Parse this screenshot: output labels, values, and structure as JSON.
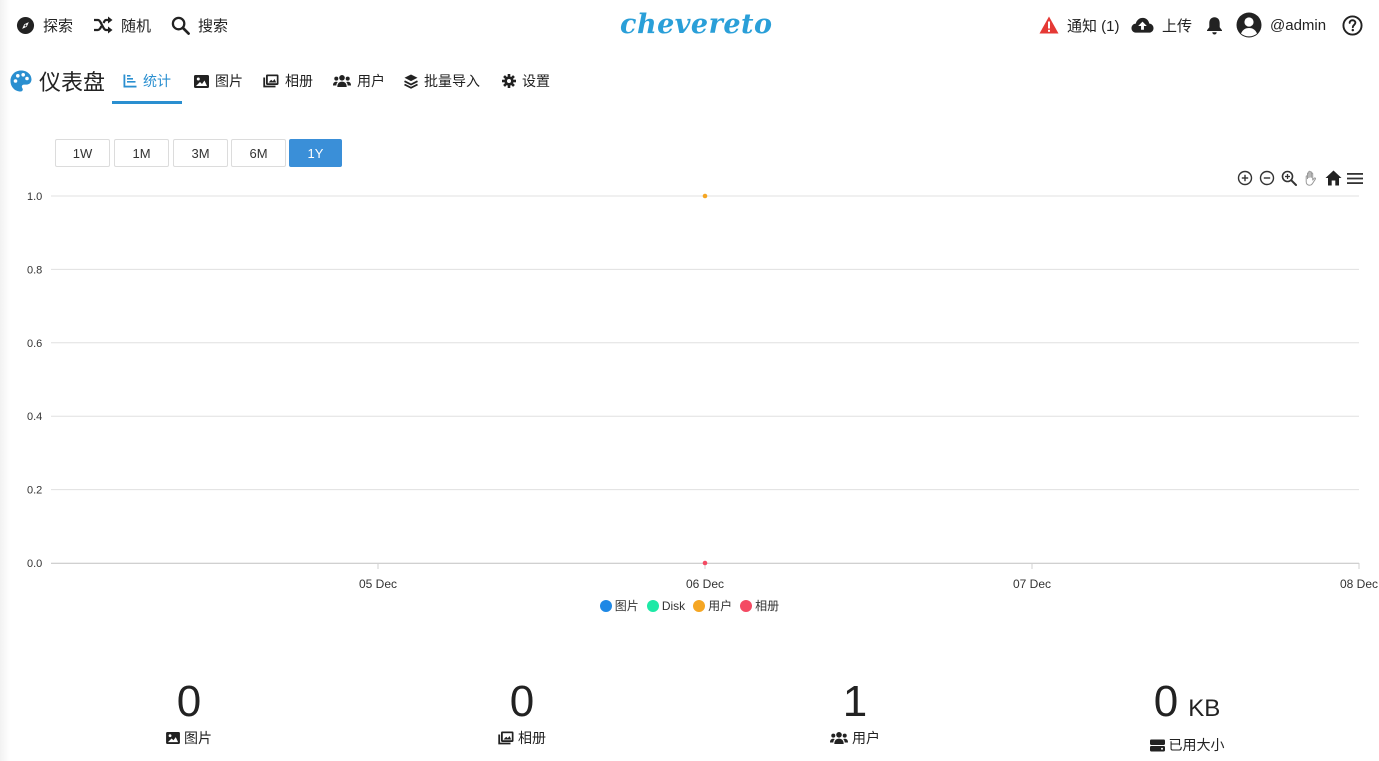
{
  "header": {
    "explore": "探索",
    "random": "随机",
    "search": "搜索",
    "logo": "chevereto",
    "notices": "通知 (1)",
    "upload": "上传",
    "user": "@admin",
    "accent_color": "#2a9fd8",
    "warning_color": "#e53935"
  },
  "tabs": {
    "dashboard": "仪表盘",
    "stats": "统计",
    "images": "图片",
    "albums": "相册",
    "users": "用户",
    "bulk": "批量导入",
    "settings": "设置"
  },
  "range": [
    "1W",
    "1M",
    "3M",
    "6M",
    "1Y"
  ],
  "range_selected": "1Y",
  "chart_data": {
    "type": "scatter",
    "x_ticks": [
      "05 Dec",
      "06 Dec",
      "07 Dec",
      "08 Dec"
    ],
    "y_ticks": [
      "1.0",
      "0.8",
      "0.6",
      "0.4",
      "0.2",
      "0.0"
    ],
    "ylim": [
      0,
      1
    ],
    "grid": true,
    "legend_position": "bottom-center",
    "series": [
      {
        "name": "图片",
        "color": "#1e88e5",
        "points": []
      },
      {
        "name": "Disk",
        "color": "#1de9a6",
        "points": []
      },
      {
        "name": "用户",
        "color": "#f5a623",
        "points": [
          {
            "x": "06 Dec",
            "y": 1
          }
        ]
      },
      {
        "name": "相册",
        "color": "#f44a63",
        "points": [
          {
            "x": "06 Dec",
            "y": 0
          }
        ]
      }
    ]
  },
  "stats": {
    "images": {
      "value": "0",
      "label": "图片"
    },
    "albums": {
      "value": "0",
      "label": "相册"
    },
    "users": {
      "value": "1",
      "label": "用户"
    },
    "disk": {
      "value": "0",
      "unit": "KB",
      "label": "已用大小"
    }
  }
}
